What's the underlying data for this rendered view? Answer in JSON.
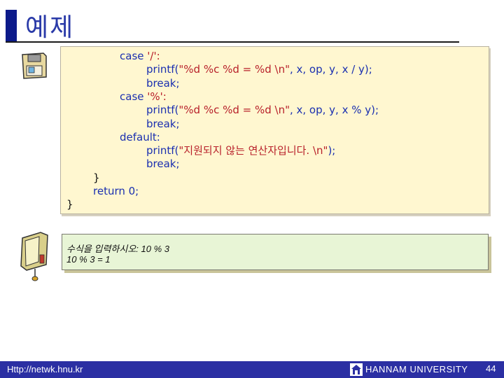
{
  "slide": {
    "title": "예제",
    "page_number": "44"
  },
  "code": {
    "lines": [
      {
        "indent": 2,
        "parts": [
          {
            "t": "case ",
            "c": "blue"
          },
          {
            "t": "'/':",
            "c": "red"
          }
        ]
      },
      {
        "indent": 3,
        "parts": [
          {
            "t": "printf(",
            "c": "blue"
          },
          {
            "t": "\"%d %c %d = %d \\n\"",
            "c": "red"
          },
          {
            "t": ", x, op, y, x / y);",
            "c": "blue"
          }
        ]
      },
      {
        "indent": 3,
        "parts": [
          {
            "t": "break;",
            "c": "blue"
          }
        ]
      },
      {
        "indent": 2,
        "parts": [
          {
            "t": "case ",
            "c": "blue"
          },
          {
            "t": "'%':",
            "c": "red"
          }
        ]
      },
      {
        "indent": 3,
        "parts": [
          {
            "t": "printf(",
            "c": "blue"
          },
          {
            "t": "\"%d %c %d = %d \\n\"",
            "c": "red"
          },
          {
            "t": ", x, op, y, x % y);",
            "c": "blue"
          }
        ]
      },
      {
        "indent": 3,
        "parts": [
          {
            "t": "break;",
            "c": "blue"
          }
        ]
      },
      {
        "indent": 2,
        "parts": [
          {
            "t": "default:",
            "c": "blue"
          }
        ]
      },
      {
        "indent": 3,
        "parts": [
          {
            "t": "printf(",
            "c": "blue"
          },
          {
            "t": "\"지원되지 않는 연산자입니다. \\n\"",
            "c": "red"
          },
          {
            "t": ");",
            "c": "blue"
          }
        ]
      },
      {
        "indent": 3,
        "parts": [
          {
            "t": "break;",
            "c": "blue"
          }
        ]
      },
      {
        "indent": 1,
        "parts": [
          {
            "t": "}",
            "c": "black"
          }
        ]
      },
      {
        "indent": 1,
        "parts": [
          {
            "t": "return 0;",
            "c": "blue"
          }
        ]
      },
      {
        "indent": 0,
        "parts": [
          {
            "t": "}",
            "c": "black"
          }
        ]
      }
    ]
  },
  "output": {
    "line1": "수식을 입력하시오: 10 % 3",
    "line2": "10 % 3 = 1"
  },
  "footer": {
    "url": "Http://netwk.hnu.kr",
    "university": "HANNAM  UNIVERSITY"
  },
  "colors": {
    "keyword_blue": "#1a2fb0",
    "string_red": "#b8202a",
    "footer_blue": "#2b2fa3",
    "code_bg": "#fff7d0",
    "output_bg": "#e8f5d6"
  },
  "icons": {
    "code_icon": "floppy-disk-icon",
    "output_icon": "monitor-icon",
    "footer_logo": "university-logo-icon"
  }
}
